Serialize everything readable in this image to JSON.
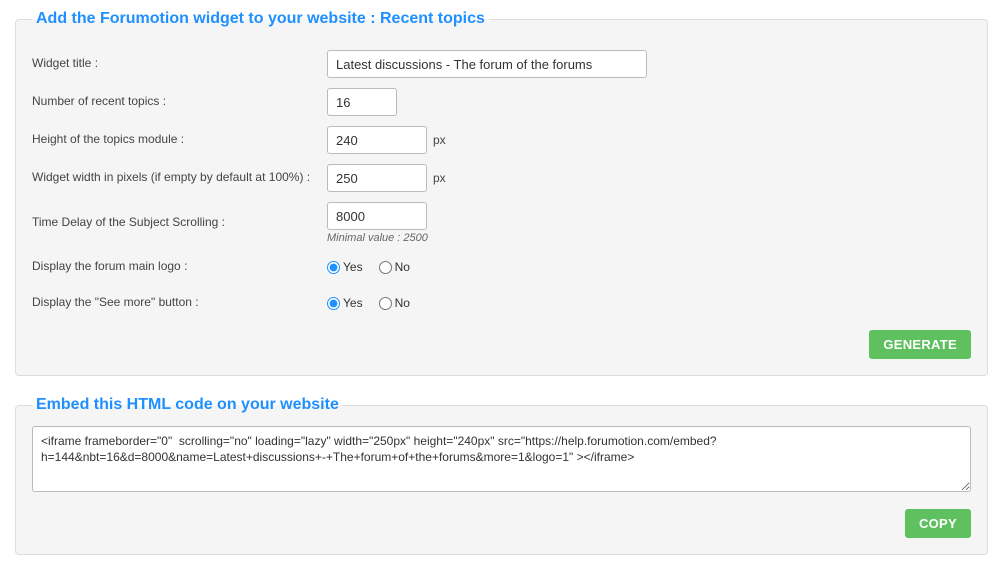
{
  "widgetSection": {
    "legend": "Add the Forumotion widget to your website : Recent topics",
    "fields": {
      "title": {
        "label": "Widget title :",
        "value": "Latest discussions - The forum of the forums"
      },
      "count": {
        "label": "Number of recent topics :",
        "value": "16"
      },
      "height": {
        "label": "Height of the topics module :",
        "value": "240",
        "suffix": "px"
      },
      "width": {
        "label": "Widget width in pixels (if empty by default at 100%) :",
        "value": "250",
        "suffix": "px"
      },
      "delay": {
        "label": "Time Delay of the Subject Scrolling :",
        "value": "8000",
        "hint": "Minimal value : 2500"
      },
      "logo": {
        "label": "Display the forum main logo :",
        "yes": "Yes",
        "no": "No",
        "value": "yes"
      },
      "seeMore": {
        "label": "Display the \"See more\" button :",
        "yes": "Yes",
        "no": "No",
        "value": "yes"
      }
    },
    "generateBtn": "GENERATE"
  },
  "embedSection": {
    "legend": "Embed this HTML code on your website",
    "code": "<iframe frameborder=\"0\"  scrolling=\"no\" loading=\"lazy\" width=\"250px\" height=\"240px\" src=\"https://help.forumotion.com/embed?h=144&nbt=16&d=8000&name=Latest+discussions+-+The+forum+of+the+forums&more=1&logo=1\" ></iframe>",
    "copyBtn": "COPY"
  }
}
